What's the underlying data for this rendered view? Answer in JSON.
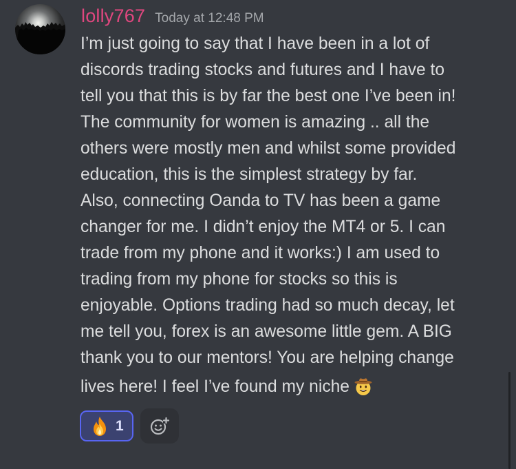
{
  "message": {
    "username": "lolly767",
    "timestamp": "Today at 12:48 PM",
    "lines": [
      "I’m just going to say that I have been in a lot of",
      "discords trading stocks and futures and I have to",
      "tell you that this is by far the best one I’ve been in!",
      "The community for women is amazing .. all the",
      "others were mostly men and whilst some provided",
      "education, this is the simplest strategy by far.",
      "Also, connecting Oanda to TV has been a game",
      "changer for me. I didn’t enjoy the MT4 or 5. I can",
      "trade from my phone and it works:)  I am used to",
      "trading from my phone for stocks so this is",
      "enjoyable. Options trading had so much decay, let",
      "me tell you, forex is an awesome little gem. A BIG",
      "thank you to our mentors! You are helping change",
      "lives here! I feel I’ve found my niche"
    ],
    "trailing_emoji": "cowboy-hat-face-emoji"
  },
  "reactions": [
    {
      "icon": "fire-emoji",
      "count": "1",
      "selected": true
    }
  ],
  "add_reaction_icon": "add-reaction-icon",
  "colors": {
    "background": "#36393f",
    "username": "#e0477f",
    "text": "#dcddde",
    "timestamp": "#a3a6aa",
    "reaction_border": "#5865f2",
    "reaction_bg": "#3b4270"
  }
}
